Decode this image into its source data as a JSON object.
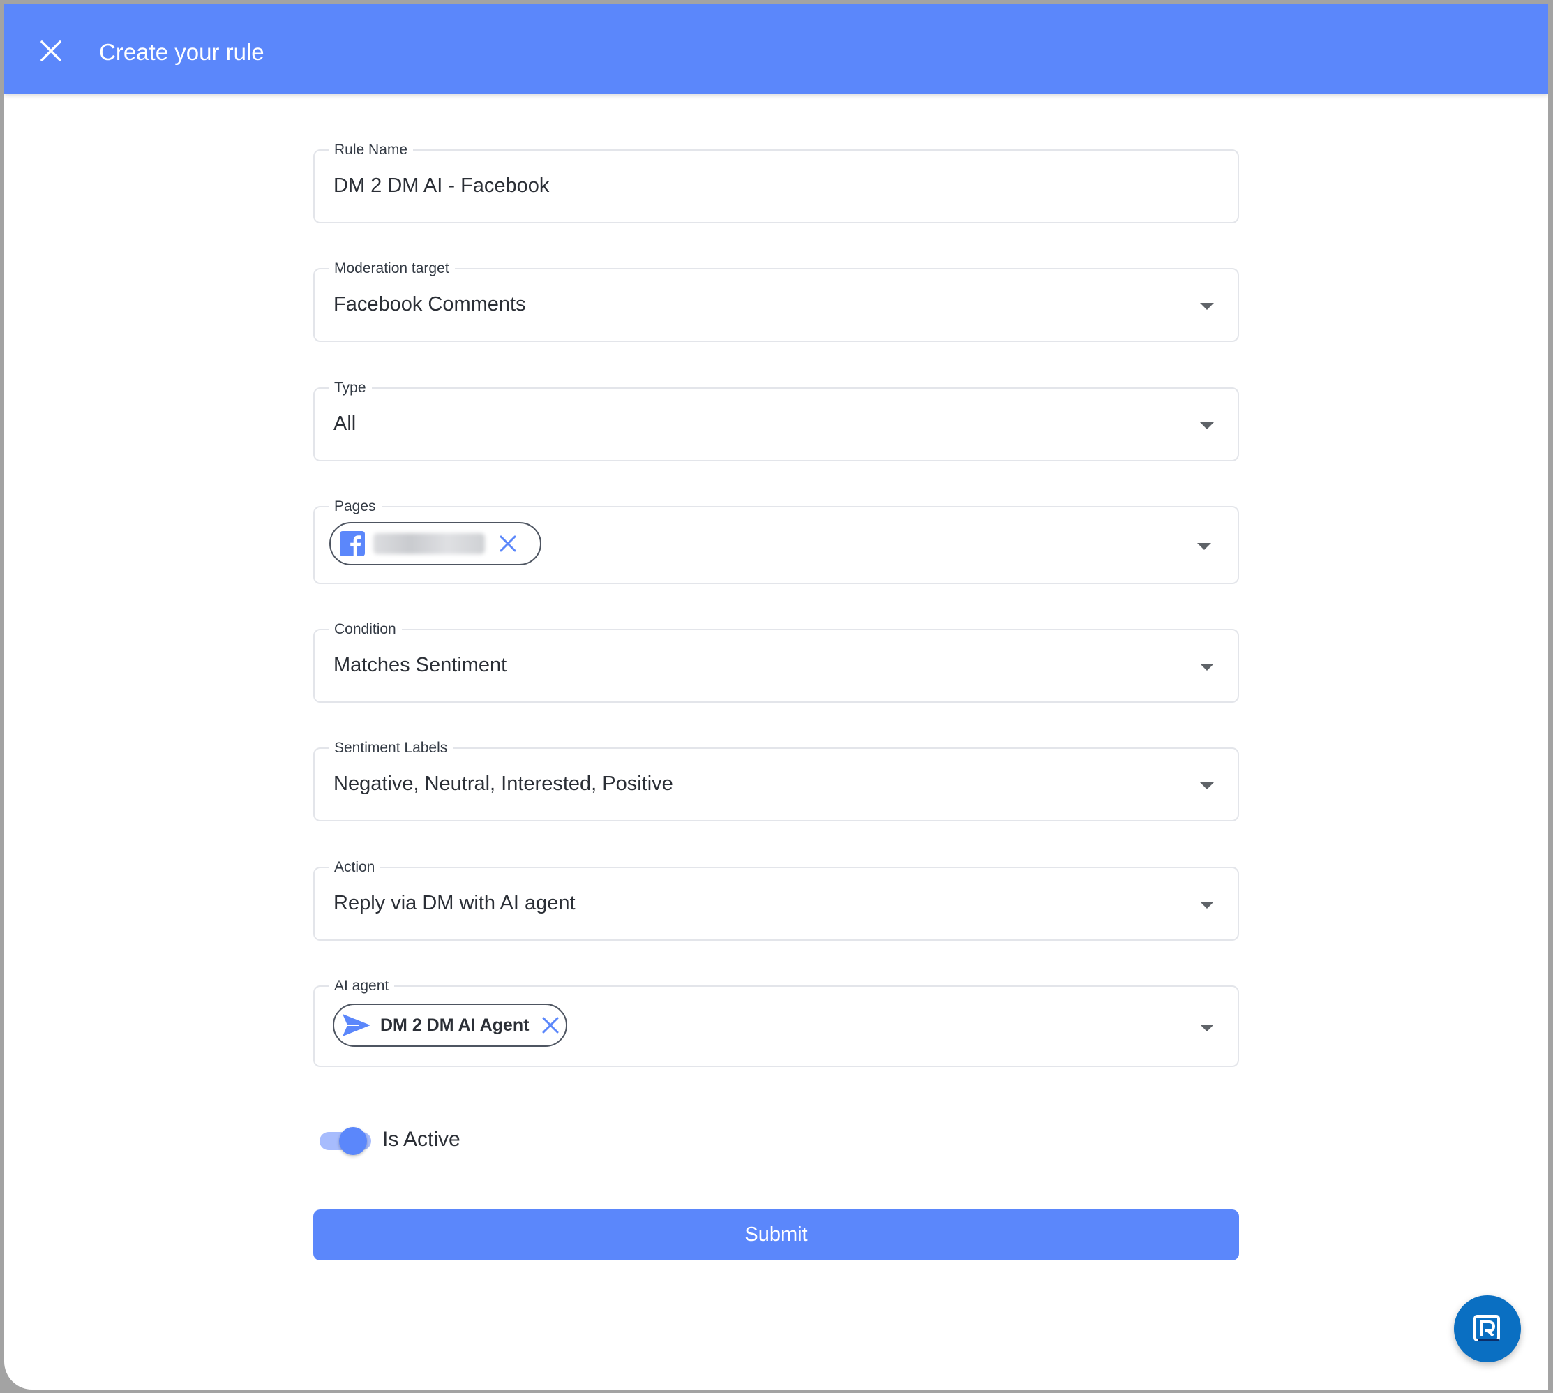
{
  "header": {
    "title": "Create your rule"
  },
  "form": {
    "rule_name": {
      "label": "Rule Name",
      "value": "DM 2 DM AI - Facebook"
    },
    "moderation_target": {
      "label": "Moderation target",
      "value": "Facebook Comments"
    },
    "type": {
      "label": "Type",
      "value": "All"
    },
    "pages": {
      "label": "Pages"
    },
    "condition": {
      "label": "Condition",
      "value": "Matches Sentiment"
    },
    "sentiment_labels": {
      "label": "Sentiment Labels",
      "value": "Negative, Neutral, Interested, Positive"
    },
    "action": {
      "label": "Action",
      "value": "Reply via DM with AI agent"
    },
    "ai_agent": {
      "label": "AI agent",
      "chip_label": "DM 2 DM AI Agent"
    },
    "is_active": {
      "label": "Is Active",
      "checked": true
    },
    "submit_label": "Submit"
  },
  "colors": {
    "primary": "#5b87fb",
    "toggle_track": "#a7bcfd",
    "fab": "#0a6fc2"
  },
  "icons": {
    "close": "close-icon",
    "facebook": "facebook-icon",
    "send": "send-icon",
    "remove": "remove-chip-icon",
    "dropdown": "chevron-down-icon",
    "fab": "brand-logo-icon"
  }
}
